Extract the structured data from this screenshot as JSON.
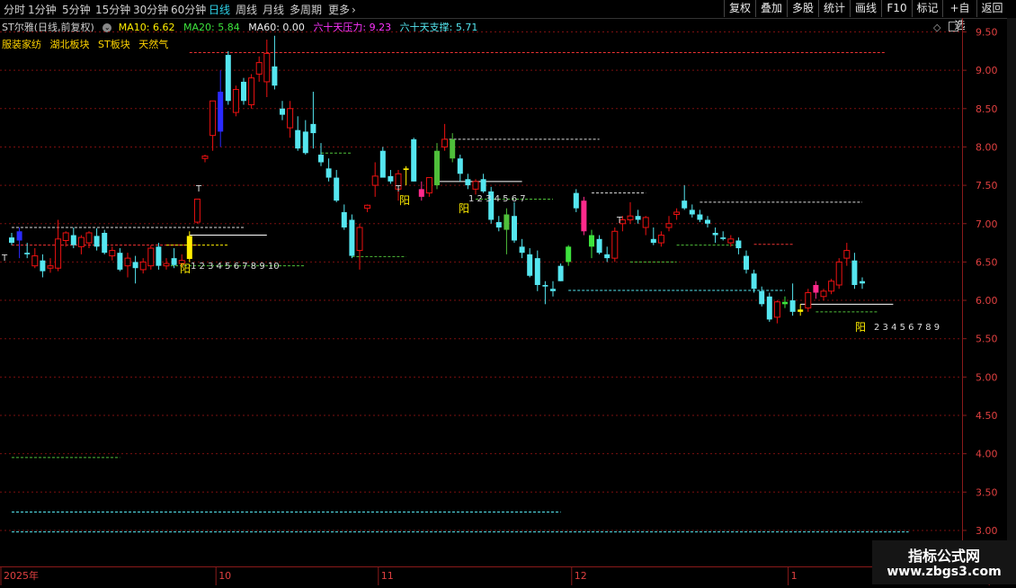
{
  "toolbar": {
    "periods": [
      "分时",
      "1分钟",
      "5分钟",
      "15分钟",
      "30分钟",
      "60分钟",
      "日线",
      "周线",
      "月线",
      "多周期",
      "更多"
    ],
    "active": "日线",
    "right_buttons": [
      "复权",
      "叠加",
      "多股",
      "统计",
      "画线",
      "F10",
      "标记",
      "+自选",
      "返回"
    ]
  },
  "info": {
    "title": "ST尔雅(日线,前复权)",
    "ma10": "MA10: 6.62",
    "ma20": "MA20: 5.84",
    "ma60": "MA60: 0.00",
    "pressure": "六十天压力: 9.23",
    "support": "六十天支撑: 5.71"
  },
  "sectors": [
    "服装家纺",
    "湖北板块",
    "ST板块",
    "天然气"
  ],
  "markers": {
    "yang": "阳",
    "count_a": "1 2 3 4 5 6 7 8 9 10",
    "count_b": "1 2 3 4 5 6 7",
    "count_c": "2 3 4 5 6 7 8 9",
    "t": "T"
  },
  "watermark": {
    "title": "指标公式网",
    "url": "www.zbgs3.com"
  },
  "colors": {
    "up": "#ee1111",
    "down": "#55e6f0",
    "grid": "#7a0f0f",
    "axis": "#8a1a1a",
    "yellow": "#ffee00",
    "green": "#4fbf3a",
    "magenta": "#ff2a8c"
  },
  "chart_data": {
    "type": "candlestick",
    "y_ticks": [
      "9.50",
      "9.00",
      "8.50",
      "8.00",
      "7.50",
      "7.00",
      "6.50",
      "6.00",
      "5.50",
      "5.00",
      "4.50",
      "4.00",
      "3.50",
      "3.00"
    ],
    "ylim": [
      2.9,
      9.6
    ],
    "x_labels": [
      {
        "label": "2025年",
        "i": 0
      },
      {
        "label": "10",
        "i": 27
      },
      {
        "label": "11",
        "i": 48
      },
      {
        "label": "12",
        "i": 73
      },
      {
        "label": "1",
        "i": 101
      },
      {
        "label": "2",
        "i": 127
      }
    ],
    "candles": [
      {
        "o": 6.82,
        "h": 6.88,
        "l": 6.72,
        "c": 6.75
      },
      {
        "o": 6.78,
        "h": 6.95,
        "l": 6.55,
        "c": 6.9
      },
      {
        "o": 6.62,
        "h": 6.75,
        "l": 6.55,
        "c": 6.6
      },
      {
        "o": 6.45,
        "h": 6.68,
        "l": 6.42,
        "c": 6.58
      },
      {
        "o": 6.52,
        "h": 6.6,
        "l": 6.3,
        "c": 6.38
      },
      {
        "o": 6.42,
        "h": 6.55,
        "l": 6.36,
        "c": 6.45
      },
      {
        "o": 6.42,
        "h": 7.05,
        "l": 6.38,
        "c": 6.8
      },
      {
        "o": 6.78,
        "h": 6.9,
        "l": 6.7,
        "c": 6.88
      },
      {
        "o": 6.85,
        "h": 6.95,
        "l": 6.68,
        "c": 6.72
      },
      {
        "o": 6.7,
        "h": 6.85,
        "l": 6.6,
        "c": 6.82
      },
      {
        "o": 6.75,
        "h": 6.9,
        "l": 6.68,
        "c": 6.88
      },
      {
        "o": 6.84,
        "h": 6.94,
        "l": 6.65,
        "c": 6.7
      },
      {
        "o": 6.88,
        "h": 6.92,
        "l": 6.6,
        "c": 6.62
      },
      {
        "o": 6.58,
        "h": 6.7,
        "l": 6.52,
        "c": 6.65
      },
      {
        "o": 6.62,
        "h": 6.68,
        "l": 6.38,
        "c": 6.4
      },
      {
        "o": 6.45,
        "h": 6.62,
        "l": 6.3,
        "c": 6.55
      },
      {
        "o": 6.5,
        "h": 6.58,
        "l": 6.22,
        "c": 6.42
      },
      {
        "o": 6.4,
        "h": 6.55,
        "l": 6.35,
        "c": 6.5
      },
      {
        "o": 6.45,
        "h": 6.72,
        "l": 6.4,
        "c": 6.68
      },
      {
        "o": 6.7,
        "h": 6.75,
        "l": 6.4,
        "c": 6.45
      },
      {
        "o": 6.45,
        "h": 6.55,
        "l": 6.4,
        "c": 6.48
      },
      {
        "o": 6.55,
        "h": 6.68,
        "l": 6.42,
        "c": 6.46
      },
      {
        "o": 6.48,
        "h": 6.6,
        "l": 6.44,
        "c": 6.52
      },
      {
        "o": 6.54,
        "h": 6.9,
        "l": 6.5,
        "c": 6.84
      },
      {
        "o": 7.02,
        "h": 7.2,
        "l": 7.0,
        "c": 7.32
      },
      {
        "o": 7.85,
        "h": 7.9,
        "l": 7.8,
        "c": 7.88
      },
      {
        "o": 8.15,
        "h": 8.4,
        "l": 7.95,
        "c": 8.6
      },
      {
        "o": 8.2,
        "h": 9.0,
        "l": 8.0,
        "c": 8.72
      },
      {
        "o": 9.2,
        "h": 9.25,
        "l": 8.55,
        "c": 8.6
      },
      {
        "o": 8.45,
        "h": 8.8,
        "l": 8.4,
        "c": 8.75
      },
      {
        "o": 8.85,
        "h": 8.9,
        "l": 8.55,
        "c": 8.6
      },
      {
        "o": 8.55,
        "h": 8.95,
        "l": 8.5,
        "c": 8.9
      },
      {
        "o": 8.95,
        "h": 9.18,
        "l": 8.85,
        "c": 9.1
      },
      {
        "o": 8.85,
        "h": 9.4,
        "l": 8.65,
        "c": 9.22
      },
      {
        "o": 9.05,
        "h": 9.45,
        "l": 8.75,
        "c": 8.8
      },
      {
        "o": 8.5,
        "h": 8.6,
        "l": 8.35,
        "c": 8.42
      },
      {
        "o": 8.25,
        "h": 8.6,
        "l": 8.12,
        "c": 8.5
      },
      {
        "o": 8.22,
        "h": 8.4,
        "l": 7.95,
        "c": 7.98
      },
      {
        "o": 8.2,
        "h": 8.35,
        "l": 7.9,
        "c": 7.92
      },
      {
        "o": 8.3,
        "h": 8.72,
        "l": 7.98,
        "c": 8.18
      },
      {
        "o": 7.9,
        "h": 8.05,
        "l": 7.75,
        "c": 7.8
      },
      {
        "o": 7.72,
        "h": 7.85,
        "l": 7.55,
        "c": 7.6
      },
      {
        "o": 7.6,
        "h": 7.7,
        "l": 7.28,
        "c": 7.3
      },
      {
        "o": 7.15,
        "h": 7.25,
        "l": 6.92,
        "c": 6.95
      },
      {
        "o": 7.05,
        "h": 7.12,
        "l": 6.55,
        "c": 6.58
      },
      {
        "o": 6.65,
        "h": 7.0,
        "l": 6.4,
        "c": 6.95
      },
      {
        "o": 7.2,
        "h": 7.25,
        "l": 7.15,
        "c": 7.24
      },
      {
        "o": 7.5,
        "h": 7.8,
        "l": 7.35,
        "c": 7.62
      },
      {
        "o": 7.95,
        "h": 8.0,
        "l": 7.62,
        "c": 7.6
      },
      {
        "o": 7.62,
        "h": 7.7,
        "l": 7.52,
        "c": 7.55
      },
      {
        "o": 7.45,
        "h": 7.7,
        "l": 7.3,
        "c": 7.65
      },
      {
        "o": 7.7,
        "h": 7.75,
        "l": 7.5,
        "c": 7.72
      },
      {
        "o": 8.1,
        "h": 8.12,
        "l": 7.55,
        "c": 7.55
      },
      {
        "o": 7.45,
        "h": 7.55,
        "l": 7.3,
        "c": 7.35
      },
      {
        "o": 7.4,
        "h": 7.55,
        "l": 7.35,
        "c": 7.6
      },
      {
        "o": 7.5,
        "h": 8.05,
        "l": 7.45,
        "c": 7.95
      },
      {
        "o": 8.0,
        "h": 8.3,
        "l": 7.95,
        "c": 8.1
      },
      {
        "o": 8.1,
        "h": 8.18,
        "l": 7.8,
        "c": 7.85
      },
      {
        "o": 7.85,
        "h": 7.9,
        "l": 7.55,
        "c": 7.65
      },
      {
        "o": 7.58,
        "h": 7.65,
        "l": 7.45,
        "c": 7.5
      },
      {
        "o": 7.45,
        "h": 7.58,
        "l": 7.38,
        "c": 7.55
      },
      {
        "o": 7.58,
        "h": 7.65,
        "l": 7.4,
        "c": 7.42
      },
      {
        "o": 7.42,
        "h": 7.48,
        "l": 7.0,
        "c": 7.05
      },
      {
        "o": 7.02,
        "h": 7.1,
        "l": 6.9,
        "c": 6.95
      },
      {
        "o": 6.92,
        "h": 7.2,
        "l": 6.6,
        "c": 7.12
      },
      {
        "o": 7.1,
        "h": 7.28,
        "l": 6.75,
        "c": 6.78
      },
      {
        "o": 6.7,
        "h": 6.8,
        "l": 6.55,
        "c": 6.62
      },
      {
        "o": 6.6,
        "h": 6.68,
        "l": 6.3,
        "c": 6.32
      },
      {
        "o": 6.55,
        "h": 6.65,
        "l": 6.12,
        "c": 6.2
      },
      {
        "o": 6.2,
        "h": 6.25,
        "l": 5.95,
        "c": 6.18
      },
      {
        "o": 6.15,
        "h": 6.25,
        "l": 6.05,
        "c": 6.12
      },
      {
        "o": 6.45,
        "h": 6.48,
        "l": 6.25,
        "c": 6.25
      },
      {
        "o": 6.5,
        "h": 6.72,
        "l": 6.45,
        "c": 6.7
      },
      {
        "o": 7.4,
        "h": 7.45,
        "l": 7.15,
        "c": 7.2
      },
      {
        "o": 7.3,
        "h": 7.35,
        "l": 6.85,
        "c": 6.9
      },
      {
        "o": 6.7,
        "h": 6.92,
        "l": 6.55,
        "c": 6.85
      },
      {
        "o": 6.8,
        "h": 6.85,
        "l": 6.6,
        "c": 6.62
      },
      {
        "o": 6.6,
        "h": 6.7,
        "l": 6.5,
        "c": 6.55
      },
      {
        "o": 6.55,
        "h": 6.95,
        "l": 6.5,
        "c": 6.9
      },
      {
        "o": 7.0,
        "h": 7.1,
        "l": 6.9,
        "c": 7.05
      },
      {
        "o": 7.05,
        "h": 7.28,
        "l": 7.0,
        "c": 7.1
      },
      {
        "o": 7.1,
        "h": 7.18,
        "l": 7.0,
        "c": 7.05
      },
      {
        "o": 6.95,
        "h": 7.1,
        "l": 6.85,
        "c": 7.08
      },
      {
        "o": 6.8,
        "h": 6.95,
        "l": 6.72,
        "c": 6.75
      },
      {
        "o": 6.75,
        "h": 6.9,
        "l": 6.7,
        "c": 6.85
      },
      {
        "o": 6.95,
        "h": 7.1,
        "l": 6.9,
        "c": 7.0
      },
      {
        "o": 7.12,
        "h": 7.2,
        "l": 7.05,
        "c": 7.15
      },
      {
        "o": 7.3,
        "h": 7.5,
        "l": 7.18,
        "c": 7.2
      },
      {
        "o": 7.18,
        "h": 7.25,
        "l": 7.08,
        "c": 7.12
      },
      {
        "o": 7.12,
        "h": 7.18,
        "l": 7.02,
        "c": 7.05
      },
      {
        "o": 7.05,
        "h": 7.1,
        "l": 6.95,
        "c": 7.0
      },
      {
        "o": 6.88,
        "h": 6.95,
        "l": 6.75,
        "c": 6.85
      },
      {
        "o": 6.82,
        "h": 6.9,
        "l": 6.78,
        "c": 6.8
      },
      {
        "o": 6.75,
        "h": 6.85,
        "l": 6.7,
        "c": 6.8
      },
      {
        "o": 6.78,
        "h": 6.82,
        "l": 6.6,
        "c": 6.68
      },
      {
        "o": 6.58,
        "h": 6.65,
        "l": 6.35,
        "c": 6.4
      },
      {
        "o": 6.35,
        "h": 6.4,
        "l": 6.1,
        "c": 6.15
      },
      {
        "o": 6.12,
        "h": 6.18,
        "l": 5.92,
        "c": 5.95
      },
      {
        "o": 6.05,
        "h": 6.1,
        "l": 5.72,
        "c": 5.75
      },
      {
        "o": 5.78,
        "h": 6.0,
        "l": 5.7,
        "c": 5.98
      },
      {
        "o": 5.95,
        "h": 6.05,
        "l": 5.9,
        "c": 5.98
      },
      {
        "o": 6.0,
        "h": 6.22,
        "l": 5.8,
        "c": 5.85
      },
      {
        "o": 5.85,
        "h": 5.95,
        "l": 5.8,
        "c": 5.88
      },
      {
        "o": 5.9,
        "h": 6.15,
        "l": 5.85,
        "c": 6.1
      },
      {
        "o": 6.1,
        "h": 6.25,
        "l": 6.02,
        "c": 6.2
      },
      {
        "o": 6.05,
        "h": 6.15,
        "l": 6.0,
        "c": 6.12
      },
      {
        "o": 6.12,
        "h": 6.28,
        "l": 6.08,
        "c": 6.25
      },
      {
        "o": 6.2,
        "h": 6.55,
        "l": 6.15,
        "c": 6.5
      },
      {
        "o": 6.55,
        "h": 6.75,
        "l": 6.45,
        "c": 6.65
      },
      {
        "o": 6.52,
        "h": 6.62,
        "l": 6.15,
        "c": 6.2
      },
      {
        "o": 6.25,
        "h": 6.3,
        "l": 6.15,
        "c": 6.22
      }
    ],
    "highlight_candles": [
      {
        "i": 1,
        "color": "#2a2aff"
      },
      {
        "i": 23,
        "color": "#ffee00"
      },
      {
        "i": 27,
        "color": "#2a2aff"
      },
      {
        "i": 51,
        "color": "#ffee00"
      },
      {
        "i": 53,
        "color": "#ff2a8c"
      },
      {
        "i": 55,
        "color": "#4fbf3a"
      },
      {
        "i": 57,
        "color": "#4fbf3a"
      },
      {
        "i": 64,
        "color": "#4fbf3a"
      },
      {
        "i": 72,
        "color": "#3de23d"
      },
      {
        "i": 74,
        "color": "#ff2a8c"
      },
      {
        "i": 75,
        "color": "#3de23d"
      },
      {
        "i": 100,
        "color": "#3de23d"
      },
      {
        "i": 102,
        "color": "#ffee00"
      },
      {
        "i": 104,
        "color": "#ff2a8c"
      }
    ],
    "level_lines": [
      {
        "y": 9.23,
        "from": 23,
        "to": 113,
        "color": "#ee3333",
        "dash": true
      },
      {
        "y": 6.95,
        "from": 0,
        "to": 30,
        "color": "#dddddd",
        "dash": true
      },
      {
        "y": 6.72,
        "from": 0,
        "to": 24,
        "color": "#ee3333",
        "dash": true
      },
      {
        "y": 6.85,
        "from": 23,
        "to": 33,
        "color": "#ffffff",
        "dash": false
      },
      {
        "y": 6.72,
        "from": 20,
        "to": 28,
        "color": "#ffee00",
        "dash": true
      },
      {
        "y": 6.45,
        "from": 20,
        "to": 38,
        "color": "#4fbf3a",
        "dash": true
      },
      {
        "y": 6.57,
        "from": 44,
        "to": 51,
        "color": "#4fbf3a",
        "dash": true
      },
      {
        "y": 7.92,
        "from": 40,
        "to": 44,
        "color": "#4fbf3a",
        "dash": true
      },
      {
        "y": 8.1,
        "from": 56,
        "to": 76,
        "color": "#dddddd",
        "dash": true
      },
      {
        "y": 7.55,
        "from": 55,
        "to": 66,
        "color": "#ffffff",
        "dash": false
      },
      {
        "y": 7.32,
        "from": 60,
        "to": 70,
        "color": "#4fbf3a",
        "dash": true
      },
      {
        "y": 6.13,
        "from": 72,
        "to": 100,
        "color": "#55e6f0",
        "dash": true
      },
      {
        "y": 7.4,
        "from": 75,
        "to": 82,
        "color": "#dddddd",
        "dash": true
      },
      {
        "y": 6.5,
        "from": 80,
        "to": 86,
        "color": "#4fbf3a",
        "dash": true
      },
      {
        "y": 7.28,
        "from": 89,
        "to": 110,
        "color": "#dddddd",
        "dash": true
      },
      {
        "y": 6.72,
        "from": 86,
        "to": 94,
        "color": "#4fbf3a",
        "dash": true
      },
      {
        "y": 6.73,
        "from": 96,
        "to": 101,
        "color": "#ee3333",
        "dash": true
      },
      {
        "y": 5.95,
        "from": 102,
        "to": 114,
        "color": "#ffffff",
        "dash": false
      },
      {
        "y": 5.85,
        "from": 104,
        "to": 112,
        "color": "#4fbf3a",
        "dash": true
      },
      {
        "y": 3.95,
        "from": 0,
        "to": 14,
        "color": "#4fbf3a",
        "dash": true
      },
      {
        "y": 3.24,
        "from": 0,
        "to": 71,
        "color": "#55e6f0",
        "dash": true
      },
      {
        "y": 2.98,
        "from": 0,
        "to": 116,
        "color": "#55e6f0",
        "dash": true
      }
    ]
  }
}
